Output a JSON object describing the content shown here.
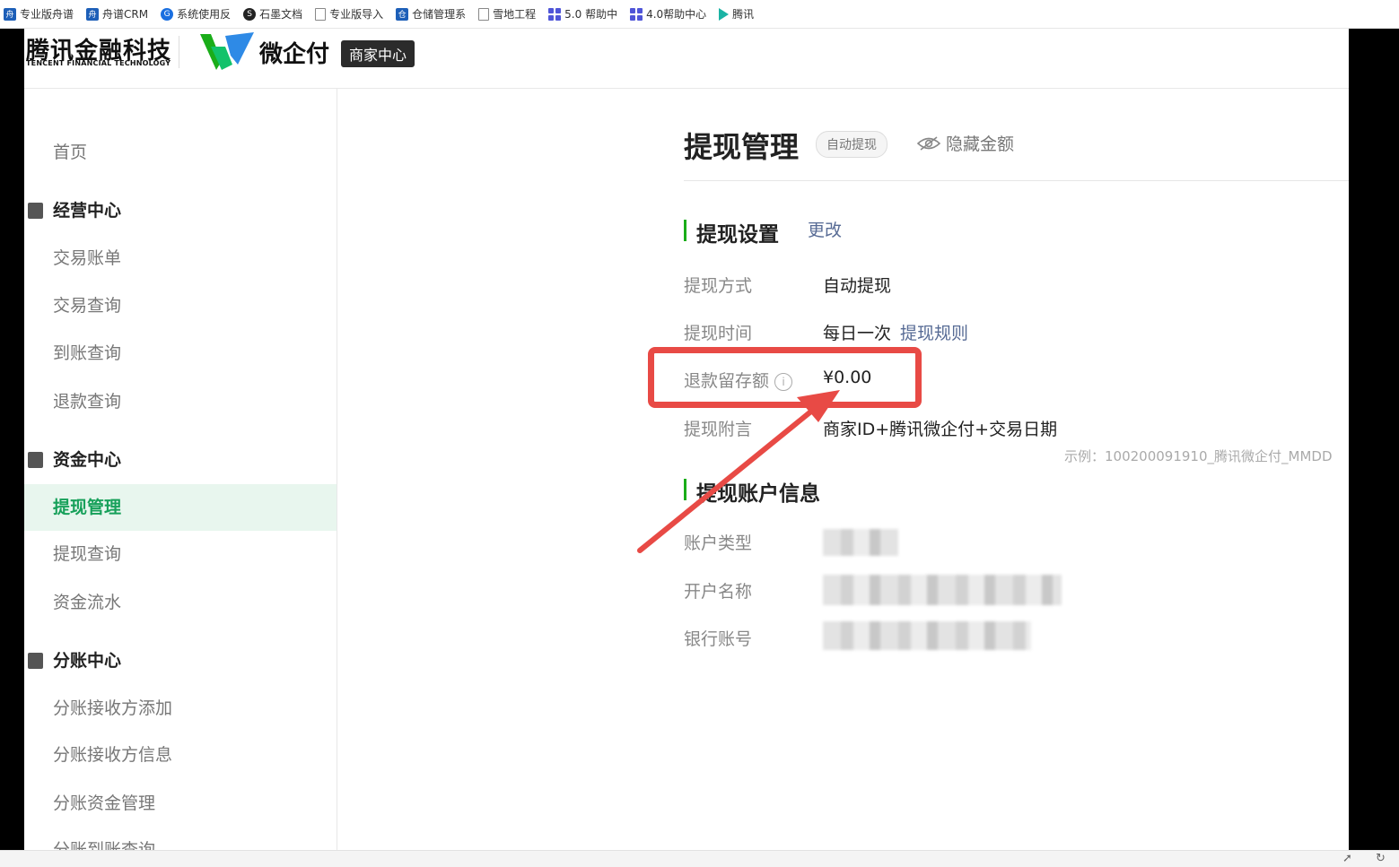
{
  "bookmarks": [
    {
      "label": "专业版舟谱",
      "icon": "blue-app-icon"
    },
    {
      "label": "舟谱CRM",
      "icon": "blue-app-icon"
    },
    {
      "label": "系统使用反",
      "icon": "round-blue-icon"
    },
    {
      "label": "石墨文档",
      "icon": "dark-round-icon"
    },
    {
      "label": "专业版导入",
      "icon": "document-icon"
    },
    {
      "label": "仓储管理系",
      "icon": "blue-app-icon"
    },
    {
      "label": "雪地工程",
      "icon": "document-icon"
    },
    {
      "label": "5.0 帮助中",
      "icon": "grid-icon"
    },
    {
      "label": "4.0帮助中心",
      "icon": "grid-icon"
    },
    {
      "label": "腾讯",
      "icon": "play-icon"
    }
  ],
  "header": {
    "brand_cn": "腾讯金融科技",
    "brand_en": "TENCENT FINANCIAL TECHNOLOGY",
    "product": "微企付",
    "product_tag": "商家中心"
  },
  "sidebar": {
    "home": "首页",
    "groups": [
      {
        "title": "经营中心",
        "items": [
          "交易账单",
          "交易查询",
          "到账查询",
          "退款查询"
        ]
      },
      {
        "title": "资金中心",
        "items": [
          "提现管理",
          "提现查询",
          "资金流水"
        ]
      },
      {
        "title": "分账中心",
        "items": [
          "分账接收方添加",
          "分账接收方信息",
          "分账资金管理",
          "分账到账查询"
        ]
      }
    ],
    "active": "提现管理"
  },
  "page": {
    "title": "提现管理",
    "mode_badge": "自动提现",
    "hide_amount": "隐藏金额",
    "settings_section": "提现设置",
    "edit_link": "更改",
    "rows": {
      "method_label": "提现方式",
      "method_value": "自动提现",
      "time_label": "提现时间",
      "time_value": "每日一次",
      "time_rule_link": "提现规则",
      "reserve_label": "退款留存额",
      "reserve_value": "¥0.00",
      "memo_label": "提现附言",
      "memo_value": "商家ID+腾讯微企付+交易日期",
      "memo_example": "示例：100200091910_腾讯微企付_MMDD"
    },
    "account_section": "提现账户信息",
    "account_rows": {
      "type_label": "账户类型",
      "name_label": "开户名称",
      "number_label": "银行账号"
    }
  },
  "colors": {
    "accent_green": "#1aad19",
    "link_blue": "#576b95",
    "highlight_red": "#e84a45"
  }
}
